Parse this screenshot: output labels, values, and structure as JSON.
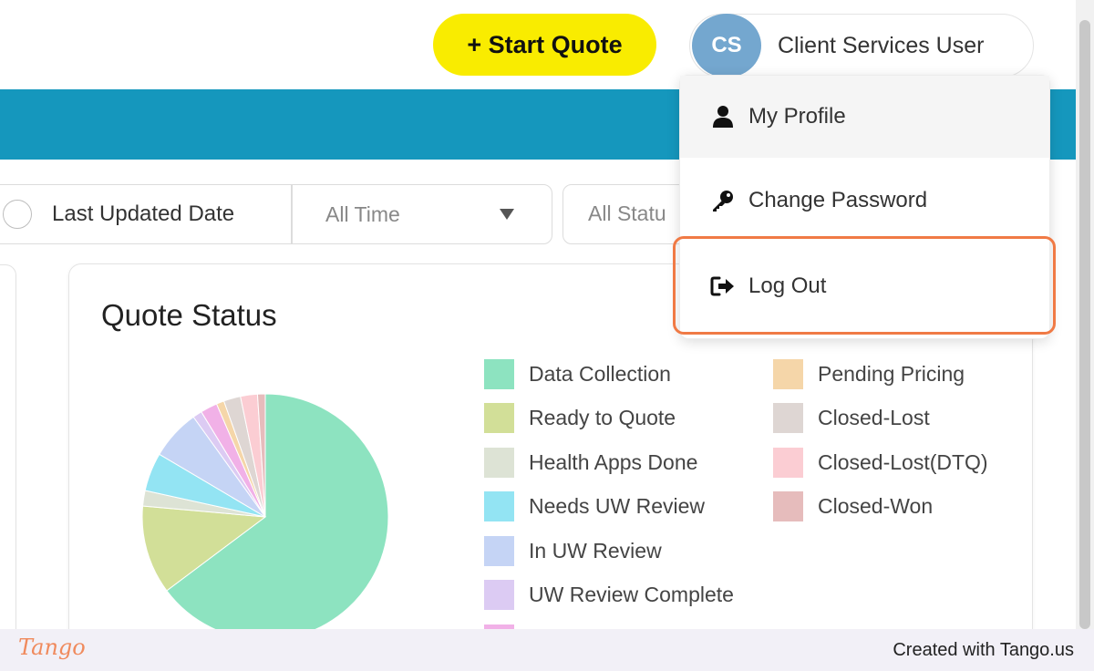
{
  "header": {
    "start_quote_label": "+ Start Quote",
    "user": {
      "initials": "CS",
      "name": "Client Services User"
    }
  },
  "filters": {
    "radio_label": "Last Updated Date",
    "time_select": "All Time",
    "status_select": "All Statu"
  },
  "dropdown": {
    "items": [
      {
        "label": "My Profile",
        "icon": "user-icon"
      },
      {
        "label": "Change Password",
        "icon": "key-icon"
      },
      {
        "label": "Log Out",
        "icon": "log-out-icon"
      }
    ]
  },
  "card": {
    "title": "Quote Status"
  },
  "chart_data": {
    "type": "pie",
    "title": "Quote Status",
    "legend_position": "right",
    "series": [
      {
        "name": "Data Collection",
        "color": "#8de3c0",
        "value": 64.0
      },
      {
        "name": "Ready to Quote",
        "color": "#d2df98",
        "value": 11.5
      },
      {
        "name": "Health Apps Done",
        "color": "#dde3d5",
        "value": 2.0
      },
      {
        "name": "Needs UW Review",
        "color": "#93e4f3",
        "value": 5.0
      },
      {
        "name": "In UW Review",
        "color": "#c5d4f5",
        "value": 6.5
      },
      {
        "name": "UW Review Complete",
        "color": "#dccbf3",
        "value": 1.2
      },
      {
        "name": "",
        "color": "#f1b1e7",
        "value": 2.2
      },
      {
        "name": "Pending Pricing",
        "color": "#f5d6a9",
        "value": 1.0
      },
      {
        "name": "Closed-Lost",
        "color": "#ded6d3",
        "value": 2.2
      },
      {
        "name": "Closed-Lost(DTQ)",
        "color": "#fbcdd3",
        "value": 2.2
      },
      {
        "name": "Closed-Won",
        "color": "#e6bcbc",
        "value": 1.0
      }
    ]
  },
  "footer": {
    "brand": "Tango",
    "credit": "Created with Tango.us"
  },
  "colors": {
    "accent_yellow": "#f9ec00",
    "banner_blue": "#1597bd",
    "highlight": "#f07a45"
  }
}
